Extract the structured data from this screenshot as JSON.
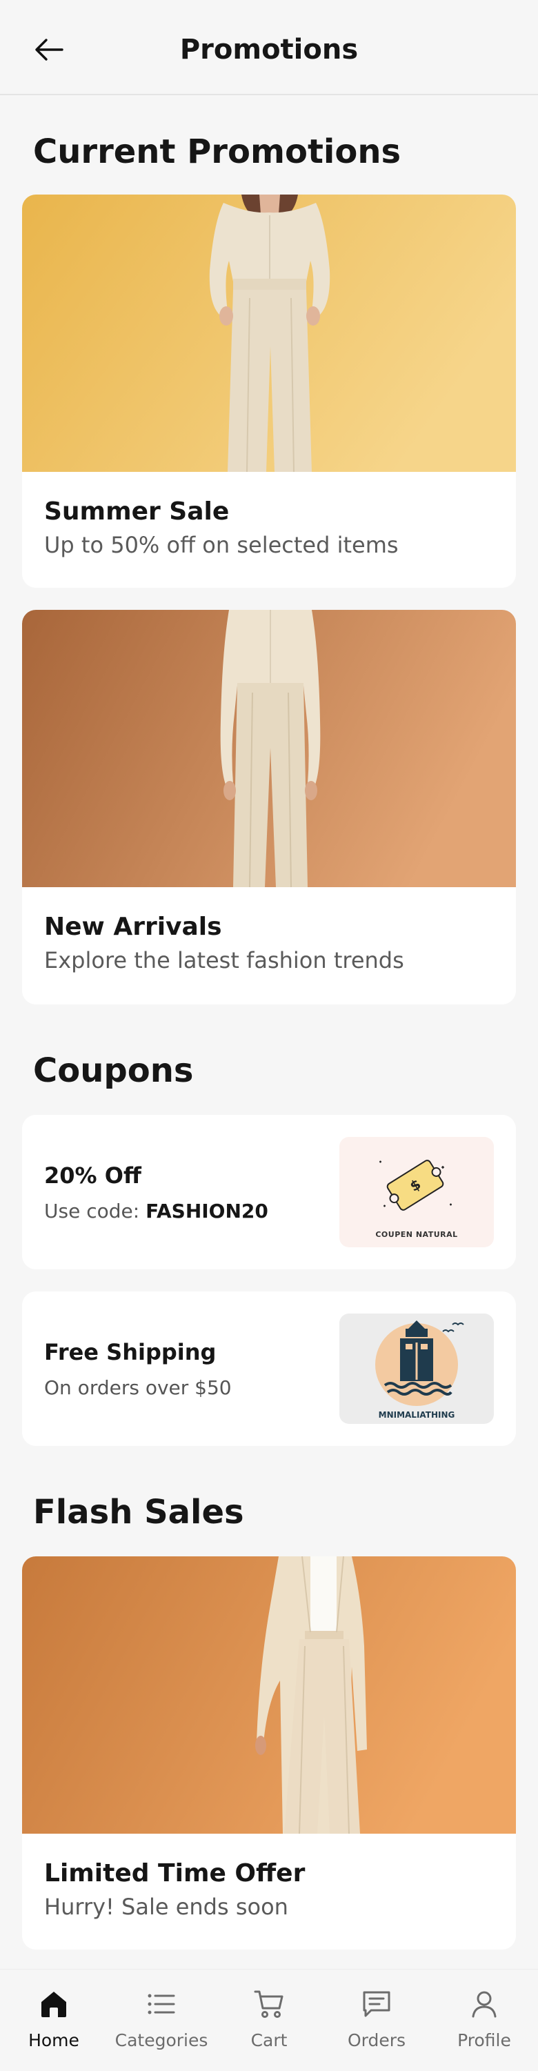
{
  "header": {
    "title": "Promotions"
  },
  "sections": {
    "current": "Current Promotions",
    "coupons": "Coupons",
    "flash": "Flash Sales"
  },
  "promotions": [
    {
      "title": "Summer Sale",
      "subtitle": "Up to 50% off on selected items",
      "bg_start": "#e9b54c",
      "bg_end": "#f6d58a"
    },
    {
      "title": "New Arrivals",
      "subtitle": "Explore the latest fashion trends",
      "bg_start": "#a8663a",
      "bg_end": "#e2a474"
    }
  ],
  "coupons": [
    {
      "title": "20% Off",
      "prefix": "Use code: ",
      "code": "FASHION20",
      "thumb_caption": "COUPEN NATURAL",
      "thumb_bg": "#fcf1ee"
    },
    {
      "title": "Free Shipping",
      "subtitle": "On orders over $50",
      "thumb_caption": "MNIMALIATHING",
      "thumb_bg": "#ececec"
    }
  ],
  "flash_sales": [
    {
      "title": "Limited Time Offer",
      "subtitle": "Hurry! Sale ends soon",
      "bg_start": "#c77a3c",
      "bg_end": "#efa664"
    }
  ],
  "nav": [
    {
      "label": "Home",
      "icon": "home-icon",
      "active": true
    },
    {
      "label": "Categories",
      "icon": "list-icon",
      "active": false
    },
    {
      "label": "Cart",
      "icon": "cart-icon",
      "active": false
    },
    {
      "label": "Orders",
      "icon": "orders-icon",
      "active": false
    },
    {
      "label": "Profile",
      "icon": "profile-icon",
      "active": false
    }
  ]
}
